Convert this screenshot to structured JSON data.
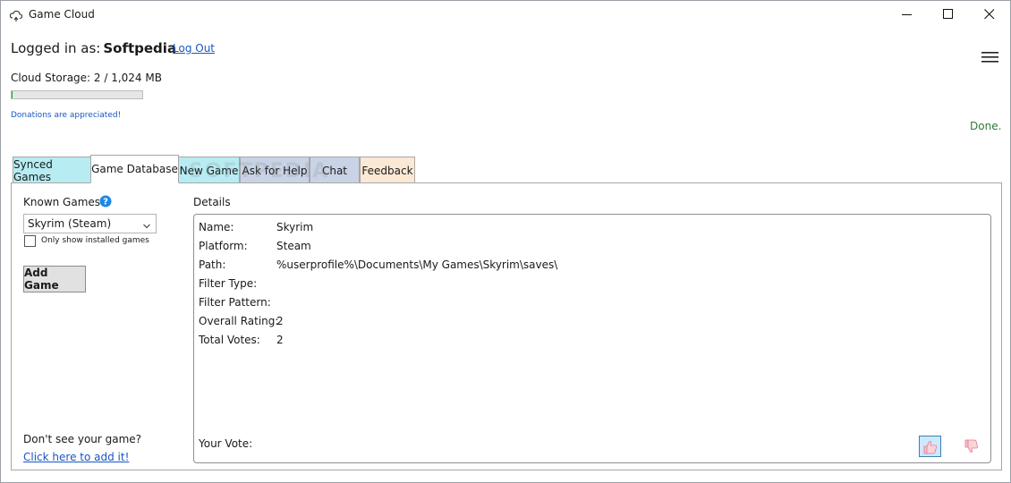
{
  "window": {
    "title": "Game Cloud",
    "icons": {
      "app": "cloud-sync-icon",
      "minimize": "minimize-icon",
      "maximize": "maximize-icon",
      "close": "close-icon"
    }
  },
  "header": {
    "logged_prefix": "Logged in as:",
    "username": "Softpedia",
    "logout_label": "Log Out",
    "menu_icon": "hamburger-icon",
    "storage_text": "Cloud Storage: 2 / 1,024 MB",
    "storage_fraction": 0.002,
    "donations_text": "Donations are appreciated!",
    "status_text": "Done."
  },
  "tabs": [
    {
      "label": "Synced Games",
      "color": "#b6ecf2"
    },
    {
      "label": "Game Database",
      "color": "#ffffff",
      "selected": true
    },
    {
      "label": "New Game",
      "color": "#b6ecf2"
    },
    {
      "label": "Ask for Help",
      "color": "#c9d3e6"
    },
    {
      "label": "Chat",
      "color": "#c9d3e6"
    },
    {
      "label": "Feedback",
      "color": "#fbe8d5"
    }
  ],
  "watermark": "SOFTPEDIA",
  "left_panel": {
    "known_games_label": "Known Games",
    "help_icon": "help-circle-icon",
    "selected_game": "Skyrim (Steam)",
    "only_installed_label": "Only show installed games",
    "only_installed_checked": false,
    "add_game_label": "Add Game",
    "dont_see_label": "Don't see your game?",
    "click_here_label": "Click here to add it!"
  },
  "details": {
    "label": "Details",
    "rows": [
      {
        "key": "Name:",
        "value": "Skyrim"
      },
      {
        "key": "Platform:",
        "value": "Steam"
      },
      {
        "key": "Path:",
        "value": "%userprofile%\\Documents\\My Games\\Skyrim\\saves\\"
      },
      {
        "key": "Filter Type:",
        "value": ""
      },
      {
        "key": "Filter Pattern:",
        "value": ""
      },
      {
        "key": "Overall Rating:",
        "value": "2"
      },
      {
        "key": "Total Votes:",
        "value": "2"
      }
    ],
    "your_vote_label": "Your Vote:",
    "vote_up_icon": "thumbs-up-icon",
    "vote_down_icon": "thumbs-down-icon"
  },
  "colors": {
    "link": "#1a56c4",
    "status_ok": "#2e7d32",
    "progress_fill": "#06b025"
  }
}
